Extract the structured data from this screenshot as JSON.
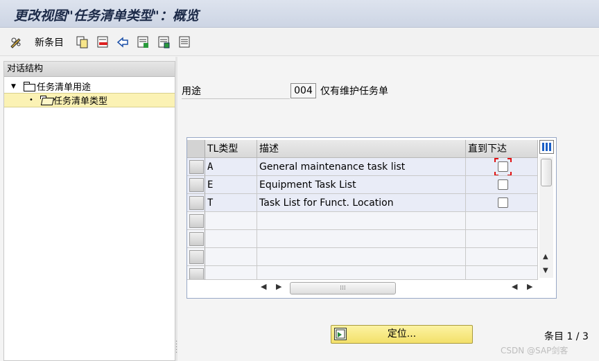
{
  "window": {
    "title": "更改视图\"任务清单类型\"：概览"
  },
  "toolbar": {
    "new_entries_label": "新条目",
    "icons": [
      "pencil-glasses-icon",
      "copy-icon",
      "delete-icon",
      "undo-icon",
      "select-all-icon",
      "select-block-icon",
      "deselect-all-icon"
    ]
  },
  "tree": {
    "header": "对话结构",
    "items": [
      {
        "label": "任务清单用途",
        "level": 0,
        "expanded": true
      },
      {
        "label": "任务清单类型",
        "level": 1,
        "selected": true
      }
    ]
  },
  "usage_field": {
    "label": "用途",
    "value": "004",
    "description": "仅有维护任务单"
  },
  "table": {
    "columns": [
      "TL类型",
      "描述",
      "直到下达"
    ],
    "rows": [
      {
        "type": "A",
        "description": "General maintenance task list",
        "until_release": false
      },
      {
        "type": "E",
        "description": "Equipment Task List",
        "until_release": false
      },
      {
        "type": "T",
        "description": "Task List for Funct. Location",
        "until_release": false
      }
    ],
    "empty_row_count": 4
  },
  "footer": {
    "locate_label": "定位...",
    "entry_label": "条目",
    "entry_current": "1",
    "entry_total": "3",
    "entry_text": "条目 1 / 3"
  },
  "watermark": "CSDN @SAP剑客",
  "colors": {
    "titlebar": "#cdd5e4",
    "selected_tree": "#fbf2b4",
    "locate_button": "#f3e06a",
    "row_bg": "#e9ecf7"
  }
}
